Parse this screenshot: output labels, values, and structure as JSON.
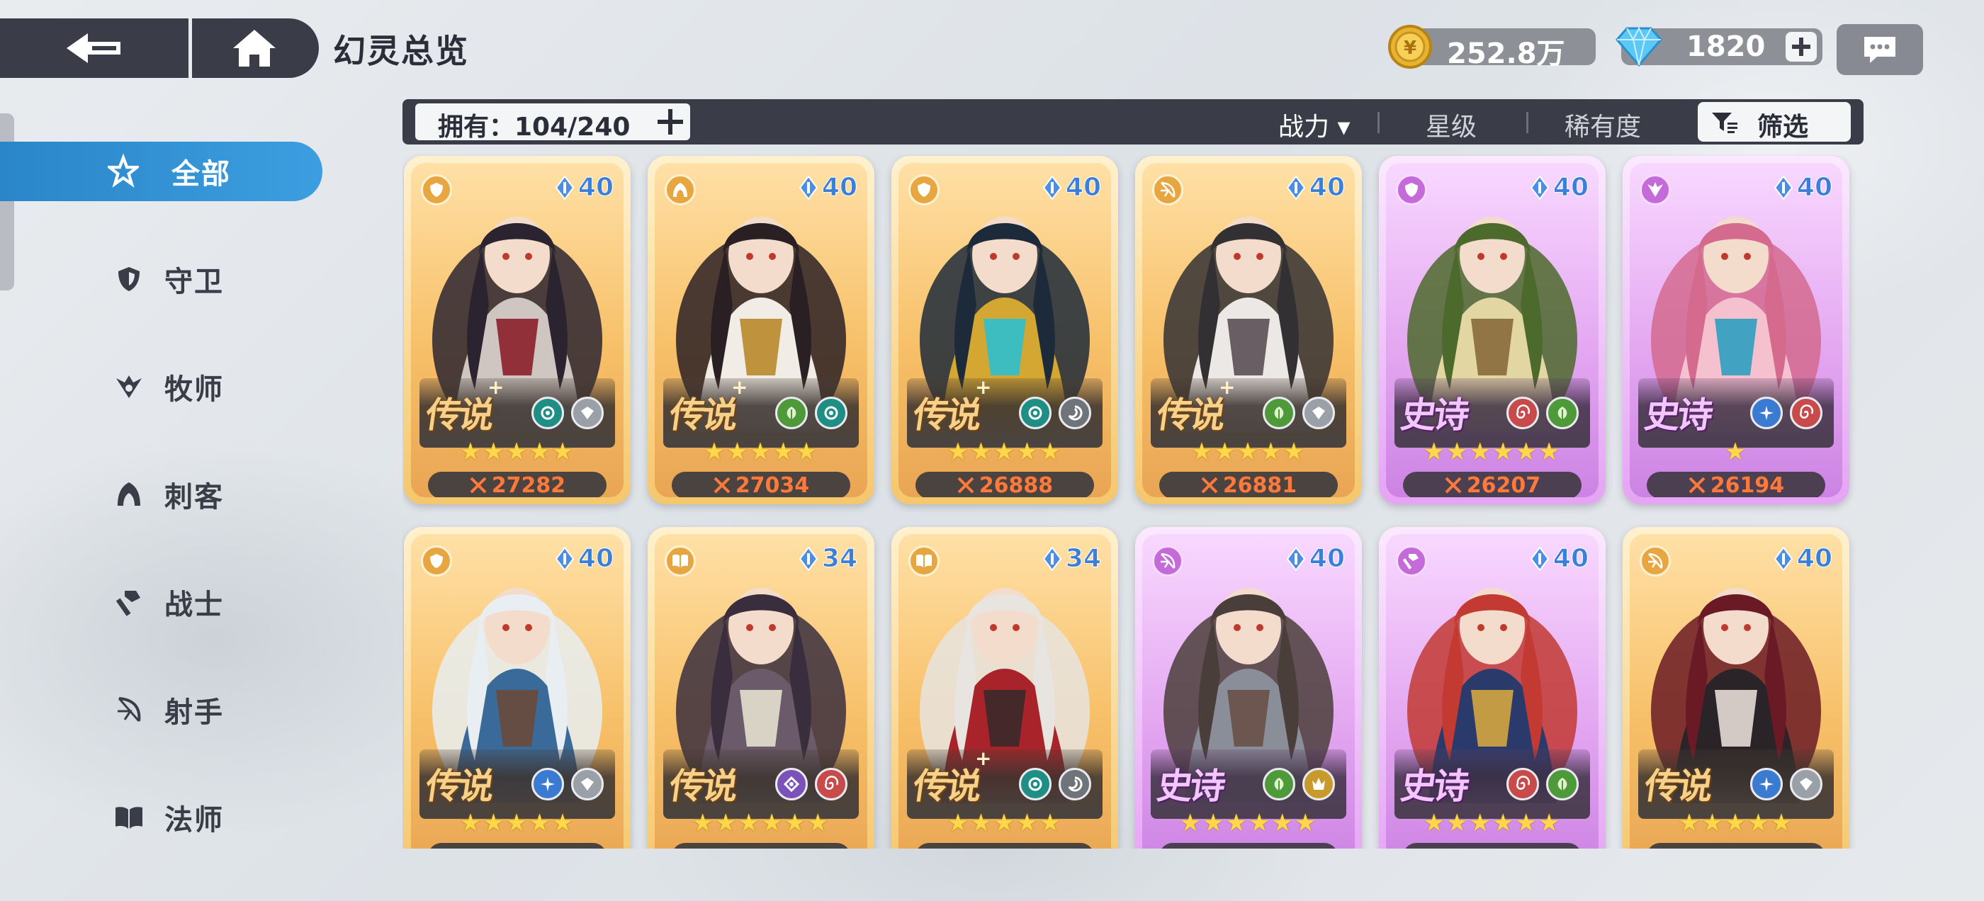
{
  "header": {
    "title": "幻灵总览",
    "back_icon": "back-arrow-icon",
    "home_icon": "home-icon"
  },
  "currency": {
    "gold": {
      "icon": "gold-coin-icon",
      "value": "252.8万"
    },
    "gem": {
      "icon": "diamond-icon",
      "value": "1820"
    },
    "chat_icon": "chat-bubble-icon"
  },
  "sidebar": {
    "items": [
      {
        "label": "全部",
        "icon": "all-star-icon",
        "active": true
      },
      {
        "label": "守卫",
        "icon": "shield-icon",
        "active": false
      },
      {
        "label": "牧师",
        "icon": "priest-wings-icon",
        "active": false
      },
      {
        "label": "刺客",
        "icon": "assassin-icon",
        "active": false
      },
      {
        "label": "战士",
        "icon": "axe-icon",
        "active": false
      },
      {
        "label": "射手",
        "icon": "bow-icon",
        "active": false
      },
      {
        "label": "法师",
        "icon": "book-icon",
        "active": false
      }
    ]
  },
  "filter": {
    "owned": "拥有：104/240",
    "sort_power": "战力 ▾",
    "sort_star": "星级",
    "sort_rarity": "稀有度",
    "filter_label": "筛选"
  },
  "colors": {
    "accent_blue": "#2a86c8",
    "legend_gold": "#f7c068",
    "epic_purple": "#e4a8f1",
    "power_orange": "#ff7a3a"
  },
  "cards": [
    {
      "rarity": "legend",
      "rarity_label": "传说",
      "plus": true,
      "class": "guardian",
      "level": "40",
      "stars": "★★★★★",
      "power": "27282",
      "elements": [
        "teal",
        "silver"
      ]
    },
    {
      "rarity": "legend",
      "rarity_label": "传说",
      "plus": true,
      "class": "assassin",
      "level": "40",
      "stars": "★★★★★",
      "power": "27034",
      "elements": [
        "green",
        "teal"
      ]
    },
    {
      "rarity": "legend",
      "rarity_label": "传说",
      "plus": true,
      "class": "guardian",
      "level": "40",
      "stars": "★★★★★",
      "power": "26888",
      "elements": [
        "teal",
        "gray"
      ]
    },
    {
      "rarity": "legend",
      "rarity_label": "传说",
      "plus": true,
      "class": "archer",
      "level": "40",
      "stars": "★★★★★",
      "power": "26881",
      "elements": [
        "green",
        "silver"
      ]
    },
    {
      "rarity": "epic",
      "rarity_label": "史诗",
      "plus": false,
      "class": "guardian",
      "level": "40",
      "stars": "★★★★★★",
      "power": "26207",
      "elements": [
        "swirl",
        "green"
      ]
    },
    {
      "rarity": "epic",
      "rarity_label": "史诗",
      "plus": false,
      "class": "priest",
      "level": "40",
      "stars": "★",
      "power": "26194",
      "elements": [
        "blue",
        "swirl"
      ]
    },
    {
      "rarity": "legend",
      "rarity_label": "传说",
      "plus": false,
      "class": "guardian",
      "level": "40",
      "stars": "★★★★★",
      "power": "",
      "elements": [
        "blue",
        "silver"
      ]
    },
    {
      "rarity": "legend",
      "rarity_label": "传说",
      "plus": false,
      "class": "mage",
      "level": "34",
      "stars": "★★★★★★",
      "power": "",
      "elements": [
        "violet",
        "swirl"
      ]
    },
    {
      "rarity": "legend",
      "rarity_label": "传说",
      "plus": true,
      "class": "mage",
      "level": "34",
      "stars": "★★★★★",
      "power": "",
      "elements": [
        "teal",
        "gray"
      ]
    },
    {
      "rarity": "epic",
      "rarity_label": "史诗",
      "plus": false,
      "class": "archer",
      "level": "40",
      "stars": "★★★★★★",
      "power": "",
      "elements": [
        "green",
        "gold"
      ]
    },
    {
      "rarity": "epic",
      "rarity_label": "史诗",
      "plus": false,
      "class": "warrior",
      "level": "40",
      "stars": "★★★★★★",
      "power": "",
      "elements": [
        "swirl",
        "green"
      ]
    },
    {
      "rarity": "legend",
      "rarity_label": "传说",
      "plus": false,
      "class": "archer",
      "level": "40",
      "stars": "★★★★★",
      "power": "",
      "elements": [
        "blue",
        "silver"
      ]
    }
  ]
}
